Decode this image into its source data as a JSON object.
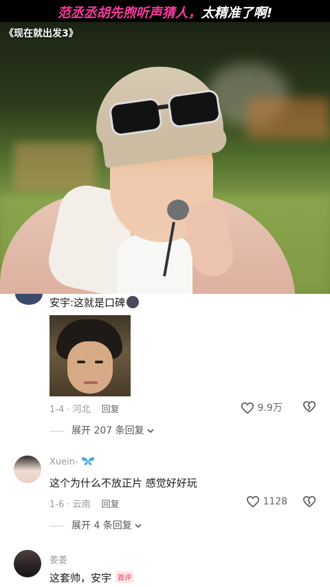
{
  "banner": {
    "title_part1": "范丞丞胡先煦听声猜人，",
    "title_part2": "太精准了啊!"
  },
  "video": {
    "label": "《现在就出发3》"
  },
  "comments": [
    {
      "text": "安宇:这就是口碑",
      "date": "1-4",
      "location": "河北",
      "reply_label": "回复",
      "likes": "9.9万",
      "expand_label": "展开 207 条回复"
    },
    {
      "username": "Xuein-",
      "text": "这个为什么不放正片 感觉好好玩",
      "date": "1-6",
      "location": "云南",
      "reply_label": "回复",
      "likes": "1128",
      "expand_label": "展开 4 条回复"
    },
    {
      "username": "姜姜",
      "text": "这套帅，安宇",
      "badge": "首评"
    }
  ],
  "icons": {
    "like": "heart-outline-icon",
    "dislike": "broken-heart-icon",
    "expand": "chevron-down-icon"
  },
  "colors": {
    "banner_pink": "#ff3aa0",
    "badge_red": "#fe2c55"
  }
}
